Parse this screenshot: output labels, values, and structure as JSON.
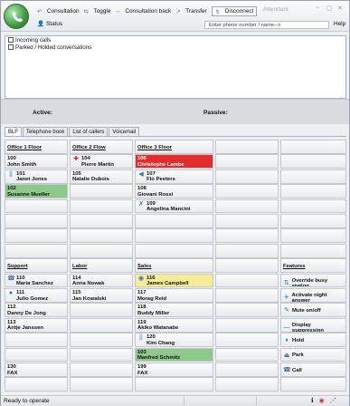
{
  "toolbar": {
    "consultation": "Consultation",
    "toggle": "Toggle",
    "consultation_back": "Consultation back",
    "transfer": "Transfer",
    "disconnect": "Disconnect",
    "attendant": "Attendant",
    "status": "Status",
    "phone_placeholder": "Enter phone number / name-->",
    "help": "Help"
  },
  "calls": [
    {
      "label": "Incoming calls",
      "icon": "incoming-calls-icon"
    },
    {
      "label": "Parked / Holded conversations",
      "icon": "parked-calls-icon"
    }
  ],
  "active_label": "Active:",
  "passive_label": "Passive:",
  "tabs": [
    "BLF",
    "Telephone book",
    "List of callers",
    "Voicemail"
  ],
  "grid": {
    "col1": [
      {
        "type": "header",
        "text": "Office 1 Floor"
      },
      {
        "num": "100",
        "name": "John Smith"
      },
      {
        "num": "101",
        "name": "Janet Jones",
        "glyph": "||"
      },
      {
        "num": "102",
        "name": "Susanne Mueller",
        "color": "green"
      },
      {},
      {},
      {},
      {},
      {
        "type": "header",
        "text": "Support"
      },
      {
        "num": "110",
        "name": "Maria Sanchez",
        "glyph": "☎"
      },
      {
        "num": "111",
        "name": "Julio Gomez",
        "glyph": "●"
      },
      {
        "num": "112",
        "name": "Danny De Jong"
      },
      {
        "num": "113",
        "name": "Antje Janssen"
      },
      {},
      {},
      {
        "num": "130",
        "name": "FAX"
      },
      {}
    ],
    "col2": [
      {
        "type": "header",
        "text": "Office 2 Flow"
      },
      {
        "num": "104",
        "name": "Pierre Martin",
        "glyph": "✚"
      },
      {
        "num": "105",
        "name": "Natalie Dubois"
      },
      {},
      {},
      {},
      {},
      {},
      {
        "type": "header",
        "text": "Labor"
      },
      {
        "num": "114",
        "name": "Anna Nowak"
      },
      {
        "num": "115",
        "name": "Jan Kowalski"
      },
      {},
      {},
      {},
      {},
      {},
      {}
    ],
    "col3": [
      {
        "type": "header",
        "text": "Office 3 Floor"
      },
      {
        "num": "106",
        "name": "Christophe Lambe",
        "color": "red"
      },
      {
        "num": "107",
        "name": "Flo Peeters",
        "glyph": "◀"
      },
      {
        "num": "108",
        "name": "Giovani Rossi"
      },
      {
        "num": "109",
        "name": "Angelina Mancini",
        "glyph": "✗"
      },
      {},
      {},
      {},
      {
        "type": "header",
        "text": "Sales"
      },
      {
        "num": "116",
        "name": "James Campbell",
        "color": "yellow",
        "glyph": "◉"
      },
      {
        "num": "117",
        "name": "Morag Reid"
      },
      {
        "num": "118",
        "name": "Buddy Miller"
      },
      {
        "num": "119",
        "name": "Akiko Watanabe"
      },
      {
        "num": "120",
        "name": "Kim Chang",
        "glyph": "||"
      },
      {
        "num": "103",
        "name": "Manfred Schmitz",
        "color": "green"
      },
      {
        "num": "199",
        "name": "FAX"
      },
      {}
    ],
    "col4": [
      {},
      {},
      {},
      {},
      {},
      {},
      {},
      {},
      {},
      {},
      {},
      {},
      {},
      {},
      {},
      {},
      {}
    ],
    "col5": [
      {},
      {},
      {},
      {},
      {},
      {},
      {},
      {},
      {
        "type": "header",
        "text": "Features"
      },
      {
        "feature": "Override busy station",
        "glyph": "⇅"
      },
      {
        "feature": "Activate night answer",
        "glyph": "☀"
      },
      {
        "feature": "Mute on/off",
        "glyph": "✎"
      },
      {
        "feature": "Display suppression",
        "glyph": "—"
      },
      {
        "feature": "Hold",
        "glyph": "⏸"
      },
      {
        "feature": "Park",
        "glyph": "⏏"
      },
      {
        "feature": "Call",
        "glyph": "☎"
      },
      {}
    ]
  },
  "statusbar": {
    "text": "Ready to operate"
  },
  "colors": {
    "busy_red": "#e32c2c",
    "free_green": "#8ec88a",
    "ringing_yellow": "#f6ee96"
  }
}
